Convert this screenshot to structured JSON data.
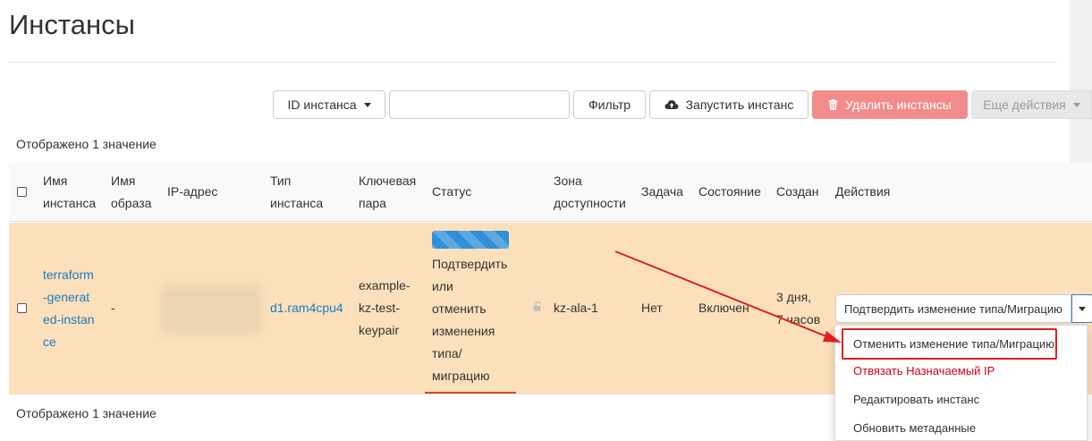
{
  "page": {
    "title": "Инстансы"
  },
  "toolbar": {
    "id_filter_label": "ID инстанса",
    "search_placeholder": "",
    "filter_label": "Фильтр",
    "launch_label": "Запустить инстанс",
    "delete_label": "Удалить инстансы",
    "more_actions_label": "Еще действия"
  },
  "summary": {
    "top": "Отображено 1 значение",
    "bottom": "Отображено 1 значение"
  },
  "table": {
    "headers": {
      "name_l1": "Имя",
      "name_l2": "инстанса",
      "image_l1": "Имя",
      "image_l2": "образа",
      "ip": "IP-адрес",
      "type_l1": "Тип",
      "type_l2": "инстанса",
      "key_l1": "Ключевая",
      "key_l2": "пара",
      "status": "Статус",
      "zone_l1": "Зона",
      "zone_l2": "доступности",
      "task": "Задача",
      "state": "Состояние",
      "created": "Создан",
      "actions": "Действия"
    },
    "row": {
      "name_lines": [
        "terraform",
        "-generat",
        "ed-instan",
        "ce"
      ],
      "image": "-",
      "ip_lines": [
        "",
        ""
      ],
      "type": "d1.ram4cpu4",
      "key_lines": [
        "example-",
        "kz-test-",
        "keypair"
      ],
      "status_lines": [
        "Подтвердить",
        "или",
        "отменить",
        "изменения",
        "типа/",
        "миграцию"
      ],
      "zone": "kz-ala-1",
      "task": "Нет",
      "state": "Включен",
      "created_lines": [
        "3 дня,",
        "7 часов"
      ],
      "action_main": "Подтвердить изменение типа/Миграцию"
    }
  },
  "action_menu": {
    "items": [
      "Отменить изменение типа/Миграцию",
      "Отвязать Назначаемый IP",
      "Редактировать инстанс",
      "Обновить метаданные"
    ]
  },
  "colors": {
    "row_highlight": "#fce0bc",
    "link": "#1a7dc0",
    "danger_button": "#f28c8c",
    "danger_text": "#d0021b",
    "annotation_red": "#e02020",
    "progress": "#2f8fd8"
  },
  "icons": {
    "launch": "cloud-upload-icon",
    "delete": "trash-icon",
    "lock": "lock-open-icon"
  }
}
